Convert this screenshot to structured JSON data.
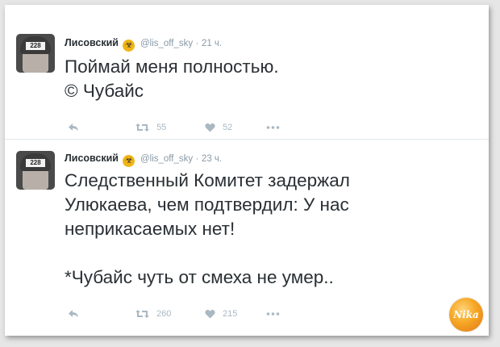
{
  "tweets": [
    {
      "name": "Лисовский",
      "handle": "@lis_off_sky",
      "dot": "·",
      "time": "21 ч.",
      "avatar_badge": "228",
      "lines": [
        "Поймай меня полностью.",
        "© Чубайс"
      ],
      "retweets": "55",
      "likes": "52"
    },
    {
      "name": "Лисовский",
      "handle": "@lis_off_sky",
      "dot": "·",
      "time": "23 ч.",
      "avatar_badge": "228",
      "lines": [
        "Следственный Комитет задержал",
        "Улюкаева, чем подтвердил: У нас",
        "неприкасаемых нет!",
        "*Чубайс чуть от смеха не умер.."
      ],
      "retweets": "260",
      "likes": "215"
    }
  ],
  "watermark": {
    "text": "Nika"
  },
  "colors": {
    "verified": "#f1b517",
    "muted": "#8899a6",
    "text": "#292f33"
  }
}
